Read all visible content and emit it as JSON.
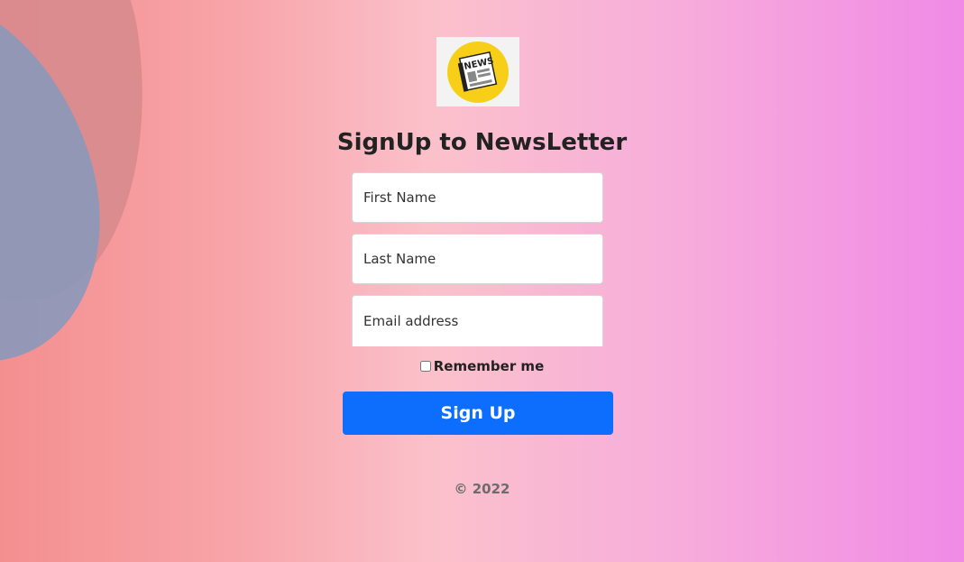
{
  "logo": {
    "icon": "newspaper-icon",
    "text": "NEWS",
    "circle_color": "#f8cf18"
  },
  "form": {
    "title": "SignUp to NewsLetter",
    "first_name_placeholder": "First Name",
    "last_name_placeholder": "Last Name",
    "email_placeholder": "Email address",
    "remember_label": "Remember me",
    "remember_checked": false,
    "submit_label": "Sign Up"
  },
  "footer": {
    "text": "© 2022"
  },
  "colors": {
    "button": "#0d6efd",
    "gradient_left": "#f48f8f",
    "gradient_right": "#f08ae6"
  }
}
